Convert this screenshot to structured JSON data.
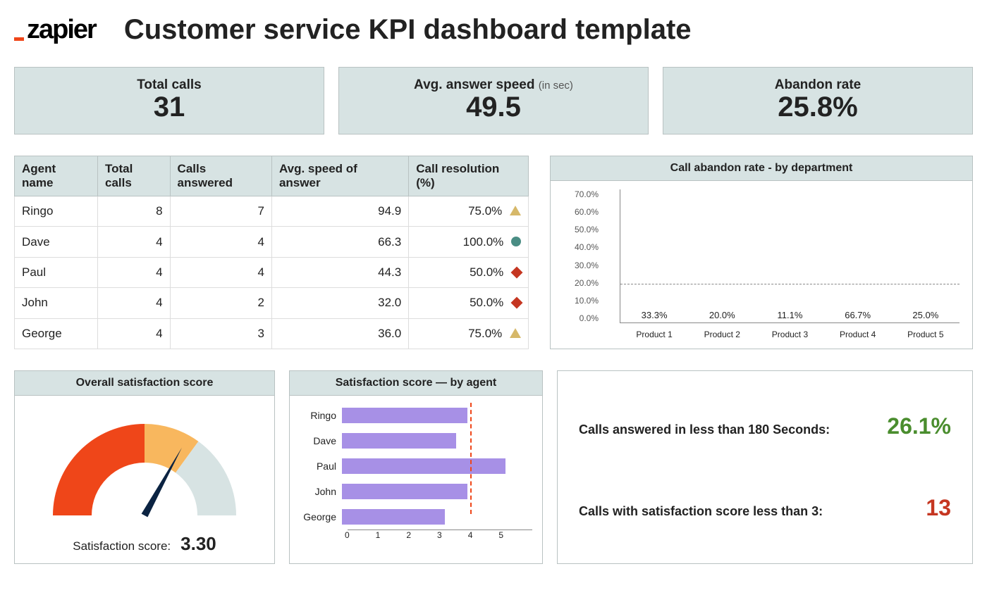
{
  "brand": "zapier",
  "page_title": "Customer service KPI dashboard template",
  "kpi": {
    "total_calls": {
      "label": "Total calls",
      "value": "31"
    },
    "avg_answer": {
      "label": "Avg. answer speed",
      "suffix": "(in sec)",
      "value": "49.5"
    },
    "abandon_rate": {
      "label": "Abandon rate",
      "value": "25.8%"
    }
  },
  "agent_table": {
    "headers": [
      "Agent name",
      "Total calls",
      "Calls answered",
      "Avg. speed of answer",
      "Call resolution (%)"
    ],
    "rows": [
      {
        "name": "Ringo",
        "total": 8,
        "answered": 7,
        "avg_speed": "94.9",
        "resolution": "75.0%",
        "status": "medium"
      },
      {
        "name": "Dave",
        "total": 4,
        "answered": 4,
        "avg_speed": "66.3",
        "resolution": "100.0%",
        "status": "good"
      },
      {
        "name": "Paul",
        "total": 4,
        "answered": 4,
        "avg_speed": "44.3",
        "resolution": "50.0%",
        "status": "bad"
      },
      {
        "name": "John",
        "total": 4,
        "answered": 2,
        "avg_speed": "32.0",
        "resolution": "50.0%",
        "status": "bad"
      },
      {
        "name": "George",
        "total": 4,
        "answered": 3,
        "avg_speed": "36.0",
        "resolution": "75.0%",
        "status": "medium"
      }
    ]
  },
  "abandon_chart_title": "Call abandon rate - by department",
  "sat_gauge": {
    "title": "Overall satisfaction score",
    "foot_label": "Satisfaction score:",
    "value": "3.30",
    "value_num": 3.3,
    "range": [
      0,
      5
    ]
  },
  "sat_by_agent": {
    "title": "Satisfaction score — by agent",
    "reference": 3.3
  },
  "stats_panel": {
    "a_label": "Calls answered in less than 180 Seconds:",
    "a_value": "26.1%",
    "b_label": "Calls with satisfaction score less than 3:",
    "b_value": "13"
  },
  "chart_data": [
    {
      "type": "bar",
      "title": "Call abandon rate - by department",
      "categories": [
        "Product 1",
        "Product 2",
        "Product 3",
        "Product 4",
        "Product 5"
      ],
      "values": [
        33.3,
        20.0,
        11.1,
        66.7,
        25.0
      ],
      "value_labels": [
        "33.3%",
        "20.0%",
        "11.1%",
        "66.7%",
        "25.0%"
      ],
      "colors": [
        "red",
        "purple",
        "purple",
        "red",
        "red"
      ],
      "ylabel": "",
      "ylim": [
        0,
        70
      ],
      "threshold": 20,
      "yticks": [
        "0.0%",
        "10.0%",
        "20.0%",
        "30.0%",
        "40.0%",
        "50.0%",
        "60.0%",
        "70.0%"
      ]
    },
    {
      "type": "bar",
      "orientation": "horizontal",
      "title": "Satisfaction score — by agent",
      "categories": [
        "Ringo",
        "Dave",
        "Paul",
        "John",
        "George"
      ],
      "values": [
        3.3,
        3.0,
        4.3,
        3.3,
        2.7
      ],
      "xlim": [
        0,
        5
      ],
      "xticks": [
        "0",
        "1",
        "2",
        "3",
        "4",
        "5"
      ],
      "reference_line": 3.3
    },
    {
      "type": "gauge",
      "title": "Overall satisfaction score",
      "value": 3.3,
      "range": [
        0,
        5
      ],
      "bands": [
        {
          "to": 2.5,
          "color": "#ef4619"
        },
        {
          "to": 3.5,
          "color": "#f8b75e"
        },
        {
          "to": 5.0,
          "color": "#d7e3e3"
        }
      ]
    }
  ]
}
